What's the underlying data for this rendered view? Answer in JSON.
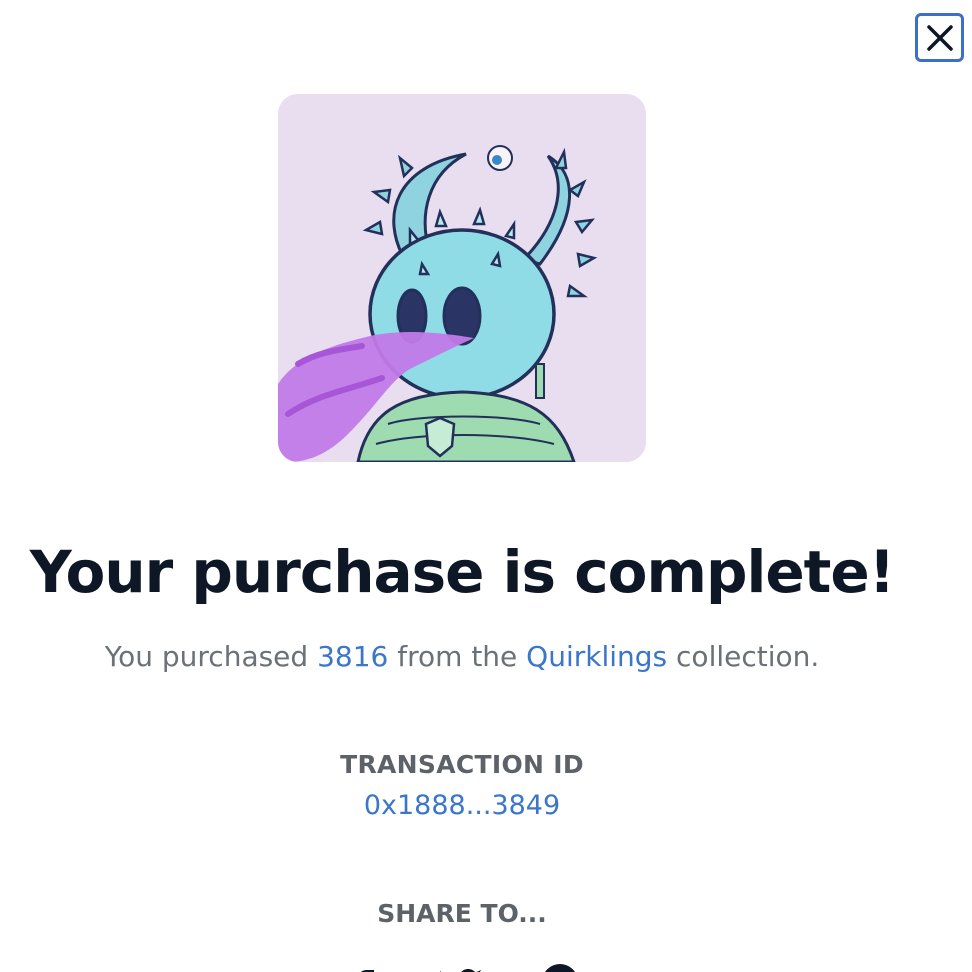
{
  "close": {
    "icon": "close-icon",
    "accent": "#3b6fc9"
  },
  "nft": {
    "icon": "quirkling-artwork"
  },
  "headline": "Your purchase is complete!",
  "purchase": {
    "prefix": "You purchased ",
    "token_id": "3816",
    "middle": " from the ",
    "collection": "Quirklings",
    "suffix": " collection."
  },
  "transaction": {
    "label": "TRANSACTION ID",
    "id": "0x1888...3849"
  },
  "share": {
    "label": "SHARE TO...",
    "icons": [
      "facebook-icon",
      "twitter-icon",
      "pinterest-icon"
    ]
  },
  "colors": {
    "link": "#3b76c9",
    "headline": "#0e1726",
    "muted": "#6b7178"
  }
}
